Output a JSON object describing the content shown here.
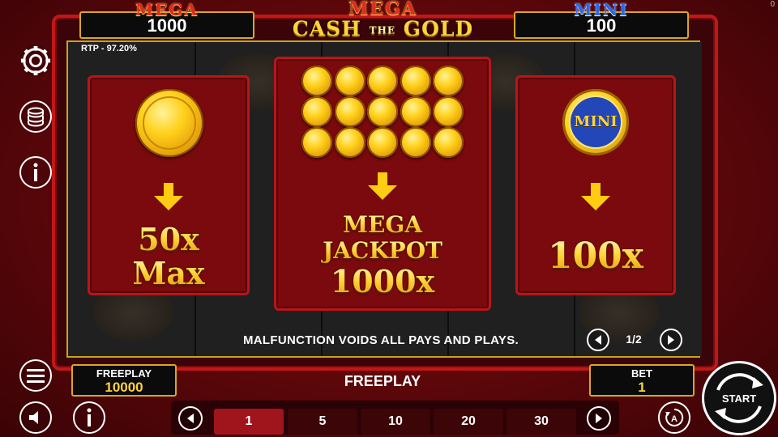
{
  "corner_counter": "0",
  "jackpots": {
    "left": {
      "title": "MEGA",
      "value": "1000"
    },
    "right": {
      "title": "MINI",
      "value": "100"
    }
  },
  "logo": {
    "line1": "MEGA",
    "line2_a": "CASH",
    "line2_the": "THE",
    "line2_b": "GOLD"
  },
  "rtp": "RTP - 97.20%",
  "panels": {
    "left": {
      "line1": "50x",
      "line2": "Max"
    },
    "center": {
      "line1": "MEGA",
      "line2": "JACKPOT",
      "line3": "1000x"
    },
    "right": {
      "coin_label": "MINI",
      "line1": "100x"
    }
  },
  "disclaimer": "MALFUNCTION VOIDS ALL PAYS AND PLAYS.",
  "pager": {
    "text": "1/2"
  },
  "freeplay_box": {
    "label": "FREEPLAY",
    "value": "10000"
  },
  "freeplay_center": "FREEPLAY",
  "bet_box": {
    "label": "BET",
    "value": "1"
  },
  "bet_options": [
    "1",
    "5",
    "10",
    "20",
    "30"
  ],
  "bet_selected_index": 0,
  "start_label": "START",
  "icons": [
    "gear-icon",
    "coin-stack-icon",
    "info-icon",
    "menu-icon",
    "sound-icon",
    "info-icon",
    "autoplay-icon",
    "arrow-left-icon",
    "arrow-right-icon"
  ],
  "colors": {
    "gold": "#ffd23a",
    "frame_red": "#c01718",
    "panel_red": "#7a0a0d",
    "mega_red": "#e02a1d",
    "mini_blue": "#2b66e8"
  }
}
